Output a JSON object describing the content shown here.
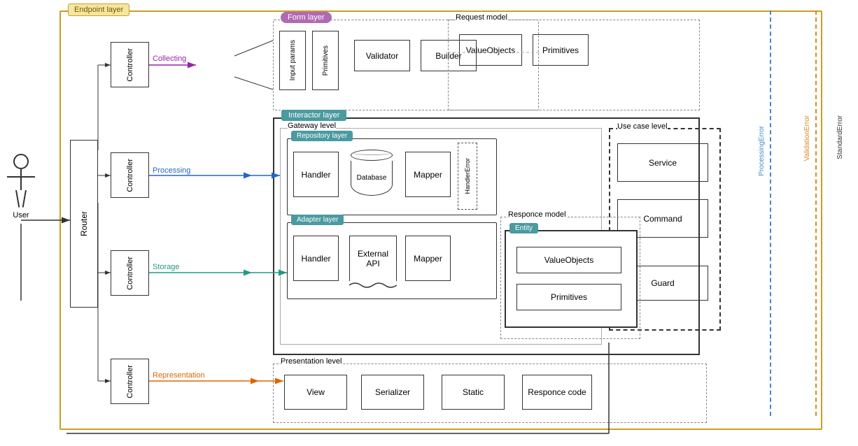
{
  "layers": {
    "endpoint": "Endpoint layer",
    "form": "Form layer",
    "interactor": "Interactor layer",
    "repository": "Repository layer",
    "adapter": "Adapter layer",
    "gateway": "Gateway level",
    "usecase": "Use case level",
    "presentation": "Presentation level"
  },
  "labels": {
    "user": "User",
    "router": "Router",
    "controller": "Controller",
    "collecting": "Collecting",
    "processing": "Processing",
    "storage": "Storage",
    "representation": "Representation",
    "input_params": "Input params",
    "primitives": "Primitives",
    "validator": "Validator",
    "builder": "Builder",
    "value_objects": "ValueObjects",
    "handler": "Handler",
    "database": "Database",
    "mapper": "Mapper",
    "handler_error": "HandlerError",
    "external_api": "External API",
    "service": "Service",
    "command": "Command",
    "guard": "Guard",
    "request_model": "Request model",
    "responce_model": "Responce model",
    "entity": "Entity",
    "value_objects2": "ValueObjects",
    "primitives2": "Primitives",
    "view": "View",
    "serializer": "Serializer",
    "static": "Static",
    "responce_code": "Responce code",
    "processing_error": "ProcessingError",
    "validation_error": "ValidationError",
    "standard_error": "StandardError"
  }
}
